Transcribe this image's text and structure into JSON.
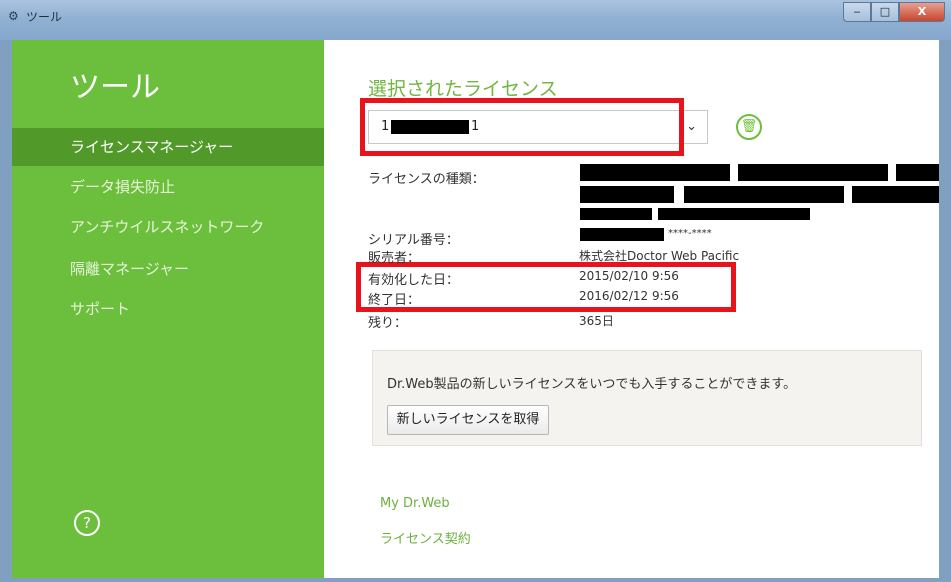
{
  "window": {
    "title": "ツール",
    "icon": "gear-icon",
    "min_label": "‒",
    "max_label": "□",
    "close_label": "X"
  },
  "sidebar": {
    "title": "ツール",
    "items": [
      {
        "label": "ライセンスマネージャー",
        "active": true
      },
      {
        "label": "データ損失防止",
        "active": false
      },
      {
        "label": "アンチウイルスネットワーク",
        "active": false
      },
      {
        "label": "隔離マネージャー",
        "active": false
      },
      {
        "label": "サポート",
        "active": false
      }
    ],
    "help_label": "?"
  },
  "main": {
    "section_title": "選択されたライセンス",
    "license_select": {
      "prefix": "1",
      "suffix": "1",
      "chevron": "⌄"
    },
    "fields": {
      "type_label": "ライセンスの種類：",
      "serial_label": "シリアル番号：",
      "serial_value": "****-****",
      "seller_label": "販売者：",
      "seller_value": "株式会社Doctor Web Pacific",
      "activated_label": "有効化した日：",
      "activated_value": "2015/02/10 9:56",
      "expires_label": "終了日：",
      "expires_value": "2016/02/12 9:56",
      "remaining_label": "残り：",
      "remaining_value": "365日"
    },
    "promo": {
      "text": "Dr.Web製品の新しいライセンスをいつでも入手することができます。",
      "button_label": "新しいライセンスを取得"
    },
    "links": {
      "my_drweb": "My Dr.Web",
      "license_agreement": "ライセンス契約"
    }
  },
  "colors": {
    "sidebar_bg": "#6cbf3c",
    "sidebar_active": "#519a29",
    "accent_green": "#72b643",
    "highlight_red": "#e8131b"
  }
}
